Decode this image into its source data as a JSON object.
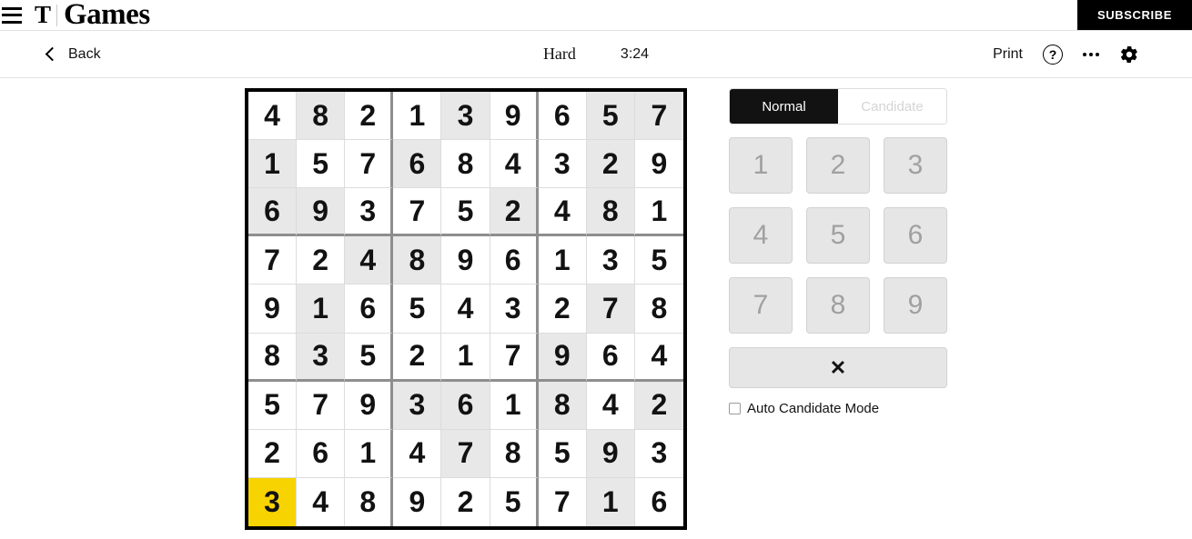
{
  "masthead": {
    "menu_icon": "hamburger-menu-icon",
    "t_logo": "T",
    "brand": "Games",
    "subscribe_label": "SUBSCRIBE"
  },
  "toolbar": {
    "back_label": "Back",
    "back_icon": "chevron-left-icon",
    "difficulty": "Hard",
    "timer": "3:24",
    "print_label": "Print",
    "help_icon": "question-mark-circle-icon",
    "help_glyph": "?",
    "more_icon": "ellipsis-icon",
    "settings_icon": "gear-icon"
  },
  "controls": {
    "mode_normal": "Normal",
    "mode_candidate": "Candidate",
    "active_mode": "Normal",
    "numpad": [
      "1",
      "2",
      "3",
      "4",
      "5",
      "6",
      "7",
      "8",
      "9"
    ],
    "erase_icon": "erase-x-icon",
    "erase_glyph": "✕",
    "auto_candidate_label": "Auto Candidate Mode",
    "auto_candidate_checked": false
  },
  "colors": {
    "selected_cell": "#f7d301",
    "clue_cell": "#e8e8e8",
    "empty_cell": "#ffffff",
    "grid_border": "#000000",
    "block_divider": "#8e8e8e",
    "cell_divider": "#dcdcdc",
    "accent_black": "#121212",
    "numpad_fill": "#e6e6e6",
    "numpad_text": "#a0a0a0"
  },
  "board": {
    "selected": {
      "row": 8,
      "col": 0
    },
    "rows": [
      {
        "values": [
          "4",
          "8",
          "2",
          "1",
          "3",
          "9",
          "6",
          "5",
          "7"
        ],
        "clue": [
          false,
          true,
          false,
          false,
          true,
          false,
          false,
          true,
          true
        ]
      },
      {
        "values": [
          "1",
          "5",
          "7",
          "6",
          "8",
          "4",
          "3",
          "2",
          "9"
        ],
        "clue": [
          true,
          false,
          false,
          true,
          false,
          false,
          false,
          true,
          false
        ]
      },
      {
        "values": [
          "6",
          "9",
          "3",
          "7",
          "5",
          "2",
          "4",
          "8",
          "1"
        ],
        "clue": [
          true,
          true,
          false,
          false,
          false,
          true,
          false,
          true,
          false
        ]
      },
      {
        "values": [
          "7",
          "2",
          "4",
          "8",
          "9",
          "6",
          "1",
          "3",
          "5"
        ],
        "clue": [
          false,
          false,
          true,
          true,
          false,
          false,
          false,
          false,
          false
        ]
      },
      {
        "values": [
          "9",
          "1",
          "6",
          "5",
          "4",
          "3",
          "2",
          "7",
          "8"
        ],
        "clue": [
          false,
          true,
          false,
          false,
          false,
          false,
          false,
          true,
          false
        ]
      },
      {
        "values": [
          "8",
          "3",
          "5",
          "2",
          "1",
          "7",
          "9",
          "6",
          "4"
        ],
        "clue": [
          false,
          true,
          false,
          false,
          false,
          false,
          true,
          false,
          false
        ]
      },
      {
        "values": [
          "5",
          "7",
          "9",
          "3",
          "6",
          "1",
          "8",
          "4",
          "2"
        ],
        "clue": [
          false,
          false,
          false,
          true,
          true,
          false,
          true,
          false,
          true
        ]
      },
      {
        "values": [
          "2",
          "6",
          "1",
          "4",
          "7",
          "8",
          "5",
          "9",
          "3"
        ],
        "clue": [
          false,
          false,
          false,
          false,
          true,
          false,
          false,
          true,
          false
        ]
      },
      {
        "values": [
          "3",
          "4",
          "8",
          "9",
          "2",
          "5",
          "7",
          "1",
          "6"
        ],
        "clue": [
          false,
          false,
          false,
          false,
          false,
          false,
          false,
          true,
          false
        ]
      }
    ]
  }
}
